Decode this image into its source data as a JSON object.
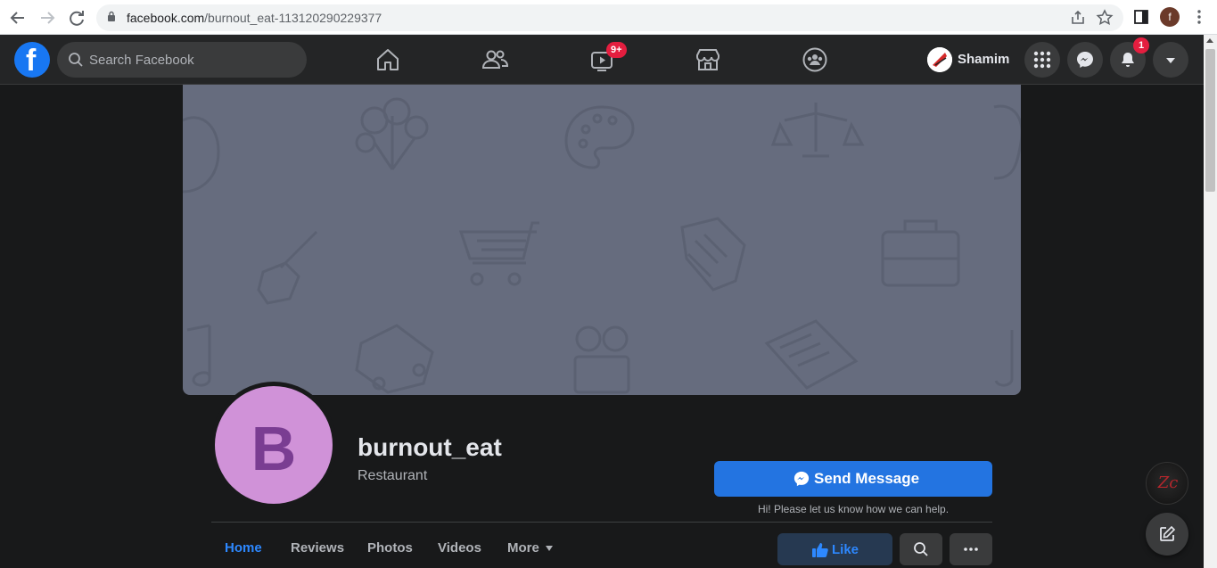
{
  "browser": {
    "url_domain": "facebook.com",
    "url_path": "/burnout_eat-113120290229377",
    "profile_initial": "f"
  },
  "nav": {
    "search_placeholder": "Search Facebook",
    "watch_badge": "9+",
    "notifications_badge": "1",
    "user_name": "Shamim"
  },
  "page": {
    "name": "burnout_eat",
    "category": "Restaurant",
    "avatar_letter": "B",
    "send_message_label": "Send Message",
    "send_help_text": "Hi! Please let us know how we can help."
  },
  "tabs": [
    {
      "label": "Home",
      "active": true
    },
    {
      "label": "Reviews"
    },
    {
      "label": "Photos"
    },
    {
      "label": "Videos"
    },
    {
      "label": "More"
    }
  ],
  "actions": {
    "like_label": "Like"
  },
  "floating": {
    "badge_text": "Zc"
  },
  "colors": {
    "accent": "#2374e1",
    "badge": "#e41e3f",
    "cover": "#666c7e",
    "avatar_bg": "#d092d8"
  }
}
